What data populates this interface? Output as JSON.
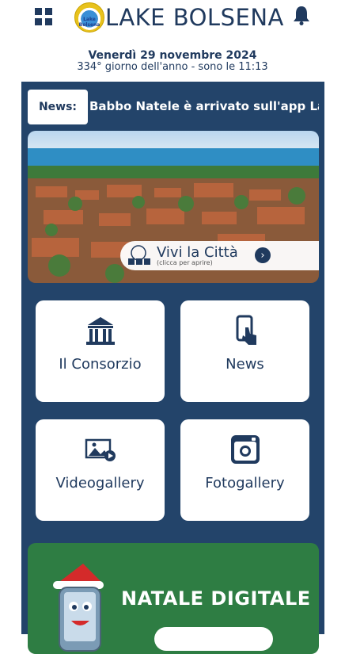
{
  "header": {
    "logo_text": "Lake Bolsena",
    "title": "LAKE BOLSENA",
    "menu_icon": "grid-menu-icon",
    "bell_icon": "bell-icon"
  },
  "date": {
    "line1": "Venerdì 29 novembre 2024",
    "line2": "334° giorno dell'anno - sono le 11:13"
  },
  "news": {
    "label": "News:",
    "ticker": "Babbo Natele è arrivato sull'app Lake Bolsena"
  },
  "hero": {
    "title": "Vivi la Città",
    "subtitle": "(clicca per aprire)"
  },
  "tiles": [
    {
      "label": "Il Consorzio",
      "icon": "building-icon"
    },
    {
      "label": "News",
      "icon": "phone-touch-icon"
    },
    {
      "label": "Videogallery",
      "icon": "video-gallery-icon"
    },
    {
      "label": "Fotogallery",
      "icon": "instagram-camera-icon"
    }
  ],
  "promo": {
    "title": "NATALE DIGITALE"
  },
  "colors": {
    "navy": "#23446a",
    "text": "#203a5e",
    "promo_green": "#2e7d43"
  }
}
